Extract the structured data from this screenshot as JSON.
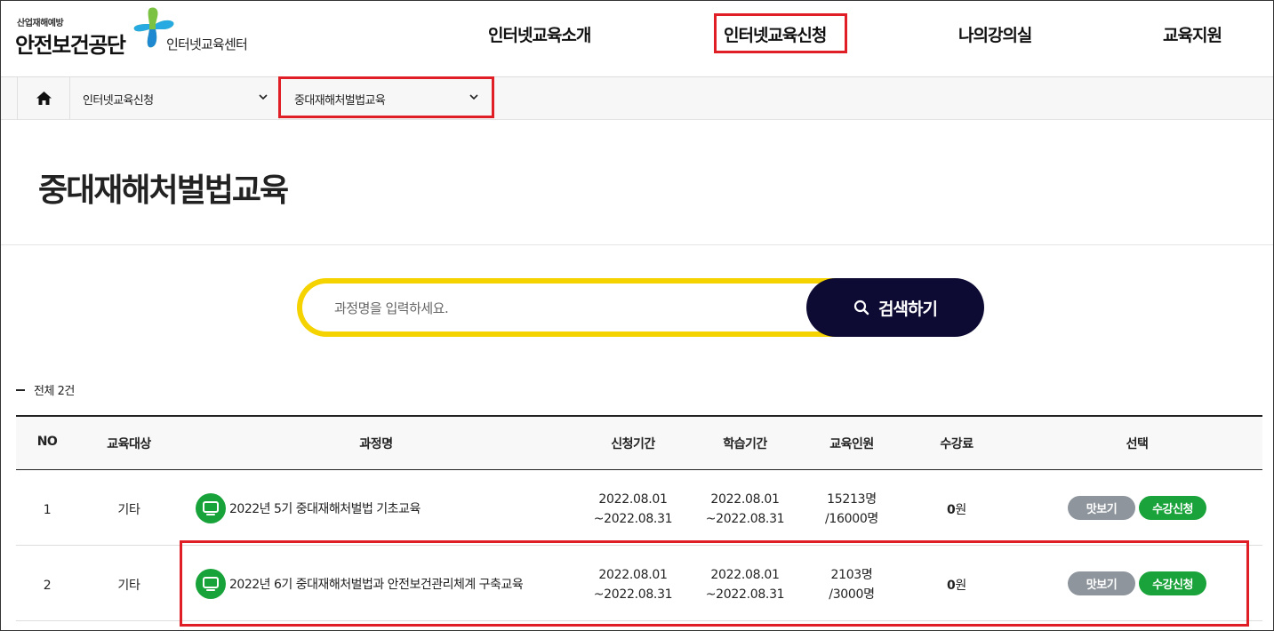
{
  "logo": {
    "small_text": "산업재해예방",
    "org_name": "안전보건공단",
    "center_name": "인터넷교육센터"
  },
  "nav": {
    "items": [
      "인터넷교육소개",
      "인터넷교육신청",
      "나의강의실",
      "교육지원"
    ]
  },
  "breadcrumb": {
    "level1": "인터넷교육신청",
    "level2": "중대재해처벌법교육"
  },
  "page": {
    "title": "중대재해처벌법교육"
  },
  "search": {
    "placeholder": "과정명을 입력하세요.",
    "button_label": "검색하기"
  },
  "list": {
    "total_label": "전체",
    "total_count": "2건",
    "headers": [
      "NO",
      "교육대상",
      "과정명",
      "신청기간",
      "학습기간",
      "교육인원",
      "수강료",
      "선택"
    ],
    "rows": [
      {
        "no": "1",
        "target": "기타",
        "course": "2022년 5기 중대재해처벌법 기초교육",
        "apply_from": "2022.08.01",
        "apply_to": "~2022.08.31",
        "study_from": "2022.08.01",
        "study_to": "~2022.08.31",
        "enrolled": "15213명",
        "capacity": "/16000명",
        "fee_amount": "0",
        "fee_unit": "원",
        "preview_label": "맛보기",
        "apply_label": "수강신청"
      },
      {
        "no": "2",
        "target": "기타",
        "course": "2022년 6기 중대재해처벌법과 안전보건관리체계 구축교육",
        "apply_from": "2022.08.01",
        "apply_to": "~2022.08.31",
        "study_from": "2022.08.01",
        "study_to": "~2022.08.31",
        "enrolled": "2103명",
        "capacity": "/3000명",
        "fee_amount": "0",
        "fee_unit": "원",
        "preview_label": "맛보기",
        "apply_label": "수강신청"
      }
    ]
  },
  "colors": {
    "highlight": "#e01e26",
    "search_border": "#f5d300",
    "search_button": "#0d0b33",
    "apply_button": "#1aa33a",
    "preview_button": "#8e959c"
  }
}
